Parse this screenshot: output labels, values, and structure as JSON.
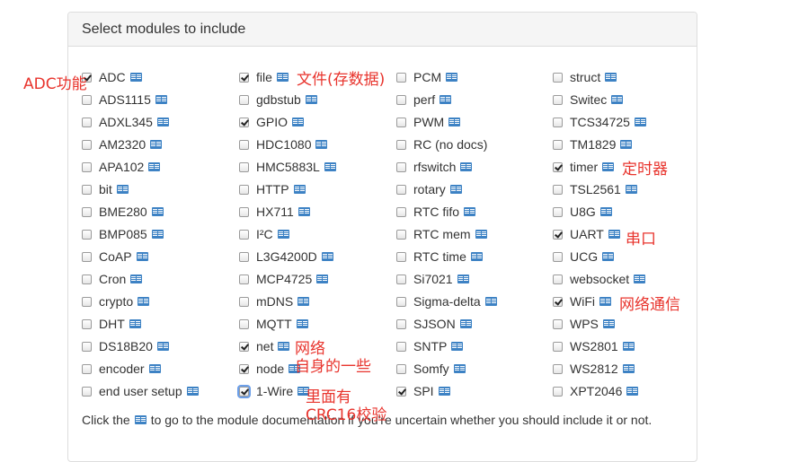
{
  "panel": {
    "title": "Select modules to include"
  },
  "columns": [
    [
      {
        "label": "ADC",
        "checked": true
      },
      {
        "label": "ADS1115",
        "checked": false
      },
      {
        "label": "ADXL345",
        "checked": false
      },
      {
        "label": "AM2320",
        "checked": false
      },
      {
        "label": "APA102",
        "checked": false
      },
      {
        "label": "bit",
        "checked": false
      },
      {
        "label": "BME280",
        "checked": false
      },
      {
        "label": "BMP085",
        "checked": false
      },
      {
        "label": "CoAP",
        "checked": false
      },
      {
        "label": "Cron",
        "checked": false
      },
      {
        "label": "crypto",
        "checked": false
      },
      {
        "label": "DHT",
        "checked": false
      },
      {
        "label": "DS18B20",
        "checked": false
      },
      {
        "label": "encoder",
        "checked": false
      },
      {
        "label": "end user setup",
        "checked": false
      }
    ],
    [
      {
        "label": "file",
        "checked": true
      },
      {
        "label": "gdbstub",
        "checked": false
      },
      {
        "label": "GPIO",
        "checked": true
      },
      {
        "label": "HDC1080",
        "checked": false
      },
      {
        "label": "HMC5883L",
        "checked": false
      },
      {
        "label": "HTTP",
        "checked": false
      },
      {
        "label": "HX711",
        "checked": false
      },
      {
        "label": "I²C",
        "checked": false
      },
      {
        "label": "L3G4200D",
        "checked": false
      },
      {
        "label": "MCP4725",
        "checked": false
      },
      {
        "label": "mDNS",
        "checked": false
      },
      {
        "label": "MQTT",
        "checked": false
      },
      {
        "label": "net",
        "checked": true
      },
      {
        "label": "node",
        "checked": true
      },
      {
        "label": "1-Wire",
        "checked": true,
        "focused": true
      }
    ],
    [
      {
        "label": "PCM",
        "checked": false
      },
      {
        "label": "perf",
        "checked": false
      },
      {
        "label": "PWM",
        "checked": false
      },
      {
        "label": "RC (no docs)",
        "checked": false,
        "no_icon": true
      },
      {
        "label": "rfswitch",
        "checked": false
      },
      {
        "label": "rotary",
        "checked": false
      },
      {
        "label": "RTC fifo",
        "checked": false
      },
      {
        "label": "RTC mem",
        "checked": false
      },
      {
        "label": "RTC time",
        "checked": false
      },
      {
        "label": "Si7021",
        "checked": false
      },
      {
        "label": "Sigma-delta",
        "checked": false
      },
      {
        "label": "SJSON",
        "checked": false
      },
      {
        "label": "SNTP",
        "checked": false
      },
      {
        "label": "Somfy",
        "checked": false
      },
      {
        "label": "SPI",
        "checked": true
      }
    ],
    [
      {
        "label": "struct",
        "checked": false
      },
      {
        "label": "Switec",
        "checked": false
      },
      {
        "label": "TCS34725",
        "checked": false
      },
      {
        "label": "TM1829",
        "checked": false
      },
      {
        "label": "timer",
        "checked": true
      },
      {
        "label": "TSL2561",
        "checked": false
      },
      {
        "label": "U8G",
        "checked": false
      },
      {
        "label": "UART",
        "checked": true
      },
      {
        "label": "UCG",
        "checked": false
      },
      {
        "label": "websocket",
        "checked": false
      },
      {
        "label": "WiFi",
        "checked": true
      },
      {
        "label": "WPS",
        "checked": false
      },
      {
        "label": "WS2801",
        "checked": false
      },
      {
        "label": "WS2812",
        "checked": false
      },
      {
        "label": "XPT2046",
        "checked": false
      }
    ]
  ],
  "footer": {
    "before": "Click the",
    "after": "to go to the module documentation if you're uncertain whether you should include it or not."
  },
  "annotations": [
    {
      "id": "adc",
      "text": "ADC功能"
    },
    {
      "id": "file",
      "text": "文件(存数据)"
    },
    {
      "id": "timer",
      "text": "定时器"
    },
    {
      "id": "uart",
      "text": "串口"
    },
    {
      "id": "wifi",
      "text": "网络通信"
    },
    {
      "id": "net",
      "text": "网络"
    },
    {
      "id": "node",
      "text": "自身的一些"
    },
    {
      "id": "onewire1",
      "text": "里面有"
    },
    {
      "id": "onewire2",
      "text": "CRC16校验"
    }
  ],
  "colors": {
    "annotation": "#e8342d",
    "doc_icon": "#3d82c4",
    "panel_heading_bg": "#f5f5f5"
  }
}
